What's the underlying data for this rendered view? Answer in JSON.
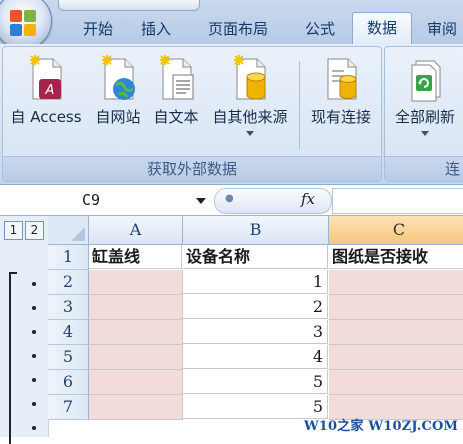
{
  "tabs": [
    {
      "label": "开始",
      "active": false
    },
    {
      "label": "插入",
      "active": false
    },
    {
      "label": "页面布局",
      "active": false
    },
    {
      "label": "公式",
      "active": false
    },
    {
      "label": "数据",
      "active": true
    },
    {
      "label": "审阅",
      "active": false
    }
  ],
  "ribbon": {
    "external_group": {
      "label": "获取外部数据",
      "buttons": [
        {
          "label": "自 Access",
          "icon": "access-database-icon"
        },
        {
          "label": "自网站",
          "icon": "web-page-globe-icon"
        },
        {
          "label": "自文本",
          "icon": "text-file-icon"
        },
        {
          "label": "自其他来源",
          "icon": "database-cylinder-icon"
        }
      ]
    },
    "existing_connections": {
      "label": "现有连接",
      "icon": "existing-connections-icon"
    },
    "connections_group": {
      "label": "连",
      "refresh_all": {
        "label": "全部刷新",
        "icon": "refresh-icon"
      }
    }
  },
  "formula_bar": {
    "name_box": "C9",
    "fx_label": "fx",
    "formula": ""
  },
  "sheet": {
    "outline_levels": [
      "1",
      "2"
    ],
    "columns": [
      "A",
      "B",
      "C"
    ],
    "selected_column": "C",
    "rows": [
      {
        "row": "1",
        "a": "缸盖线",
        "b": "设备名称",
        "c": "图纸是否接收"
      },
      {
        "row": "2",
        "a": "",
        "b": "1",
        "c": ""
      },
      {
        "row": "3",
        "a": "",
        "b": "2",
        "c": ""
      },
      {
        "row": "4",
        "a": "",
        "b": "3",
        "c": ""
      },
      {
        "row": "5",
        "a": "",
        "b": "4",
        "c": ""
      },
      {
        "row": "6",
        "a": "",
        "b": "5",
        "c": ""
      },
      {
        "row": "7",
        "a": "",
        "b": "5",
        "c": ""
      }
    ]
  },
  "watermark": "W10之家 W10ZJ.COM",
  "colors": {
    "ribbon_bg": "#d7e4f3",
    "cell_fill": "#f2dcdb",
    "selected_header": "#f5c77a",
    "accent_text": "#15396a"
  }
}
